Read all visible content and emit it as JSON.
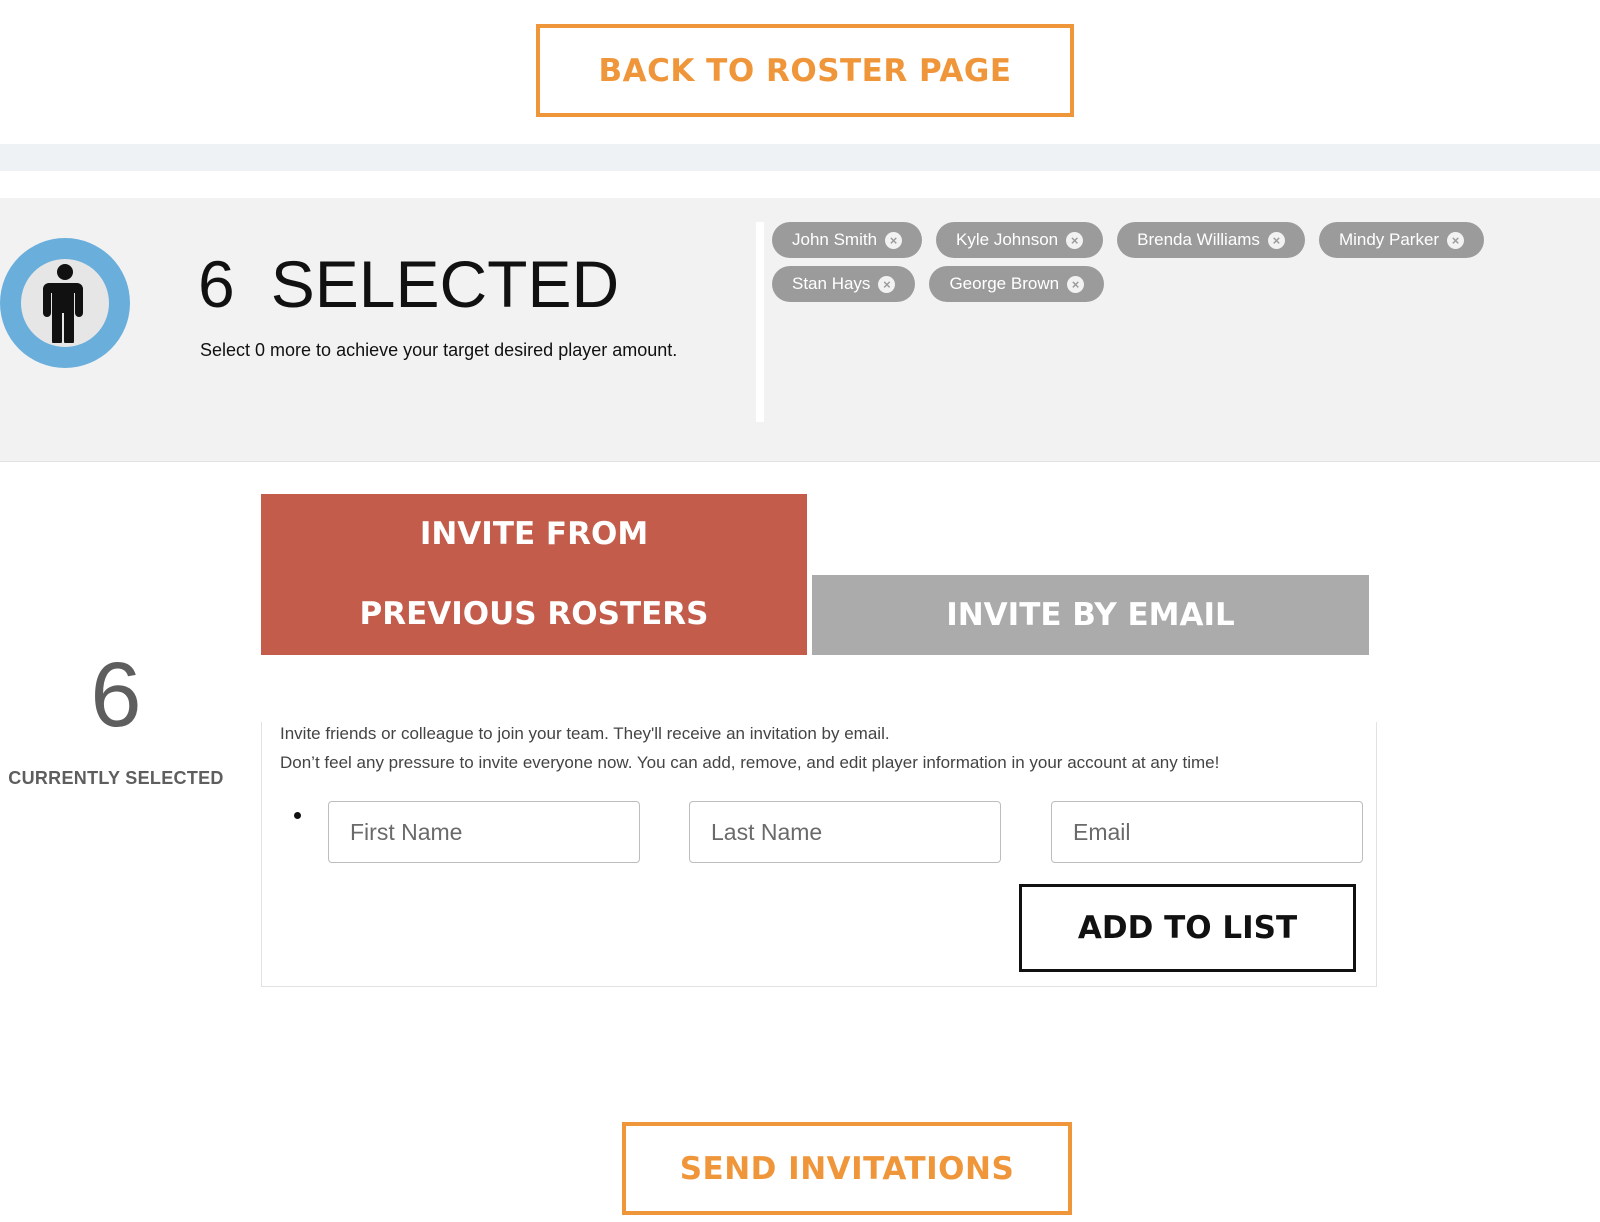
{
  "header": {
    "back_label": "BACK TO ROSTER PAGE"
  },
  "summary": {
    "avatar_icon": "person-icon",
    "count": "6",
    "count_word": "SELECTED",
    "note": "Select 0 more to achieve your target desired player amount.",
    "players": [
      {
        "name": "John Smith"
      },
      {
        "name": "Kyle Johnson"
      },
      {
        "name": "Brenda Williams"
      },
      {
        "name": "Mindy Parker"
      },
      {
        "name": "Stan Hays"
      },
      {
        "name": "George Brown"
      }
    ],
    "remove_icon": "close-icon"
  },
  "sidebar": {
    "count": "6",
    "label": "CURRENTLY SELECTED"
  },
  "tabs": {
    "previous": "INVITE FROM PREVIOUS ROSTERS",
    "email": "INVITE BY EMAIL"
  },
  "form": {
    "intro_line1": "Invite friends or colleague to join your team. They'll receive an invitation by email.",
    "intro_line2": "Don’t feel any pressure to invite everyone now. You can add, remove, and edit player information in your account at any time!",
    "first_name_placeholder": "First Name",
    "last_name_placeholder": "Last Name",
    "email_placeholder": "Email",
    "add_label": "ADD TO LIST"
  },
  "footer": {
    "send_label": "SEND INVITATIONS"
  },
  "colors": {
    "accent_orange": "#f0963a",
    "tab_active": "#c35c4a",
    "tab_inactive": "#ababab",
    "avatar_ring": "#6aaedc",
    "chip_bg": "#9b9b9b"
  }
}
